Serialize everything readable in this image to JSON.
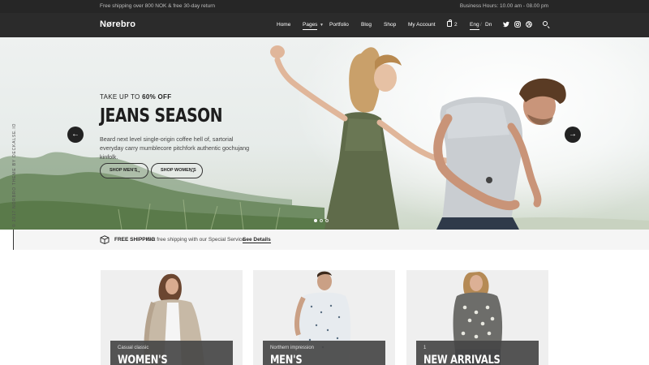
{
  "topbar": {
    "left_text": "Free shipping over 800 NOK & free 30-day return",
    "right_text": "Business Hours: 10.00 am - 08.00 pm"
  },
  "header": {
    "logo": "Nørebro",
    "nav": [
      "Home",
      "Pages",
      "Portfolio",
      "Blog",
      "Shop",
      "My Account"
    ],
    "active_nav": "Pages",
    "cart_count": "2",
    "languages": [
      "Eng",
      "Dn"
    ],
    "active_language": "Eng",
    "social_icons": [
      "twitter-icon",
      "instagram-icon",
      "dribbble-icon"
    ],
    "search_icon": "search-icon"
  },
  "hero": {
    "promo_prefix": "TAKE UP TO",
    "promo_bold": "60% OFF",
    "title": "JEANS SEASON",
    "description": "Beard next level single-origin coffee hell of, sartorial everyday carry mumblecore pitchfork authentic gochujang kinfolk.",
    "buttons": [
      "SHOP MEN'S",
      "SHOP WOMEN'S"
    ],
    "slide_count": 3,
    "active_slide": 1
  },
  "side_text": "© 2017 NORBRO THEME BY DECKALSE.IO",
  "shipping": {
    "title": "FREE SHIPPING",
    "text": "Get free shipping with our Special Service.",
    "link": "See Details"
  },
  "categories": [
    {
      "subtitle": "Casual classic",
      "title": "WOMEN'S"
    },
    {
      "subtitle": "Northern impression",
      "title": "MEN'S"
    },
    {
      "subtitle": "1",
      "title": "NEW ARRIVALS"
    }
  ],
  "colors": {
    "dark_bar": "#262626",
    "header_bg": "#2b2b2b",
    "card_label_bg": "#464646",
    "shipbar_bg": "#f5f5f5"
  }
}
